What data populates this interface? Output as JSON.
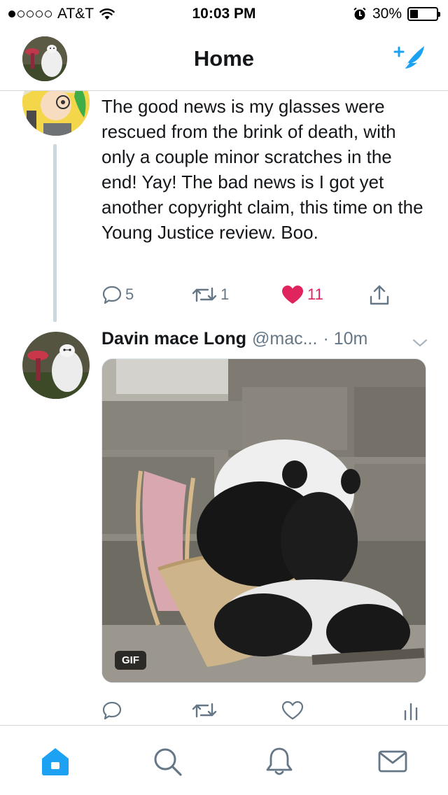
{
  "status_bar": {
    "carrier": "AT&T",
    "time": "10:03 PM",
    "battery": "30%",
    "battery_level": 0.3,
    "signal_bars_filled": 1,
    "signal_bars_total": 5
  },
  "header": {
    "title": "Home",
    "compose_icon": "compose-feather-icon",
    "avatar_icon": "profile-avatar"
  },
  "tweets": [
    {
      "text": "The good news is my glasses were rescued from the brink of death, with only a couple minor scratches in the end! Yay! The bad news is I got yet another copyright claim, this time on the Young Justice review. Boo.",
      "replies": "5",
      "retweets": "1",
      "likes": "11",
      "liked": true
    },
    {
      "author_name": "Davin mace Long",
      "author_handle": "@mac...",
      "time": "· 10m",
      "media_badge": "GIF"
    }
  ],
  "tabbar": {
    "items": [
      "home-icon",
      "search-icon",
      "notifications-icon",
      "messages-icon"
    ],
    "active": "home-icon"
  },
  "colors": {
    "accent": "#1da1f2",
    "like": "#e0245e",
    "secondary_text": "#657786",
    "divider": "#ccd6dd"
  }
}
